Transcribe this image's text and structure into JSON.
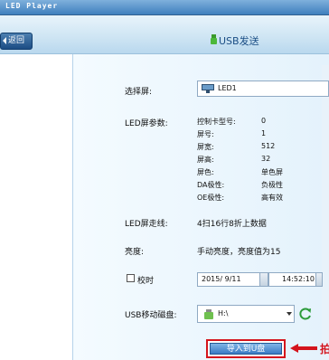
{
  "window": {
    "title": "LED Player"
  },
  "toolbar": {
    "back_label": "返回",
    "page_title": "USB发送"
  },
  "form": {
    "screen_label": "选择屏:",
    "screen_value": "LED1",
    "params_label": "LED屏参数:",
    "params": [
      {
        "key": "控制卡型号:",
        "value": "0"
      },
      {
        "key": "屏号:",
        "value": "1"
      },
      {
        "key": "屏宽:",
        "value": "512"
      },
      {
        "key": "屏高:",
        "value": "32"
      },
      {
        "key": "屏色:",
        "value": "单色屏"
      },
      {
        "key": "DA极性:",
        "value": "负极性"
      },
      {
        "key": "OE极性:",
        "value": "高有效"
      }
    ],
    "scan_label": "LED屏走线:",
    "scan_value": "4扫16行8折上数据",
    "brightness_label": "亮度:",
    "brightness_value": "手动亮度，亮度值为15",
    "time_check_label": "校时",
    "date_value": "2015/ 9/11",
    "time_value": "14:52:10",
    "usb_label": "USB移动磁盘:",
    "usb_value": "H:\\",
    "import_label": "导入到U盘",
    "annotation_char": "拍"
  },
  "colors": {
    "title_bar": "#3f7fbd",
    "back_button": "#1c4c84",
    "highlight_red": "#d4141c",
    "import_button": "#3a7bc4"
  },
  "icons": {
    "back": "arrow-left-icon",
    "usb": "usb-icon",
    "monitor": "monitor-icon",
    "drive": "usb-drive-icon",
    "refresh": "refresh-icon"
  }
}
